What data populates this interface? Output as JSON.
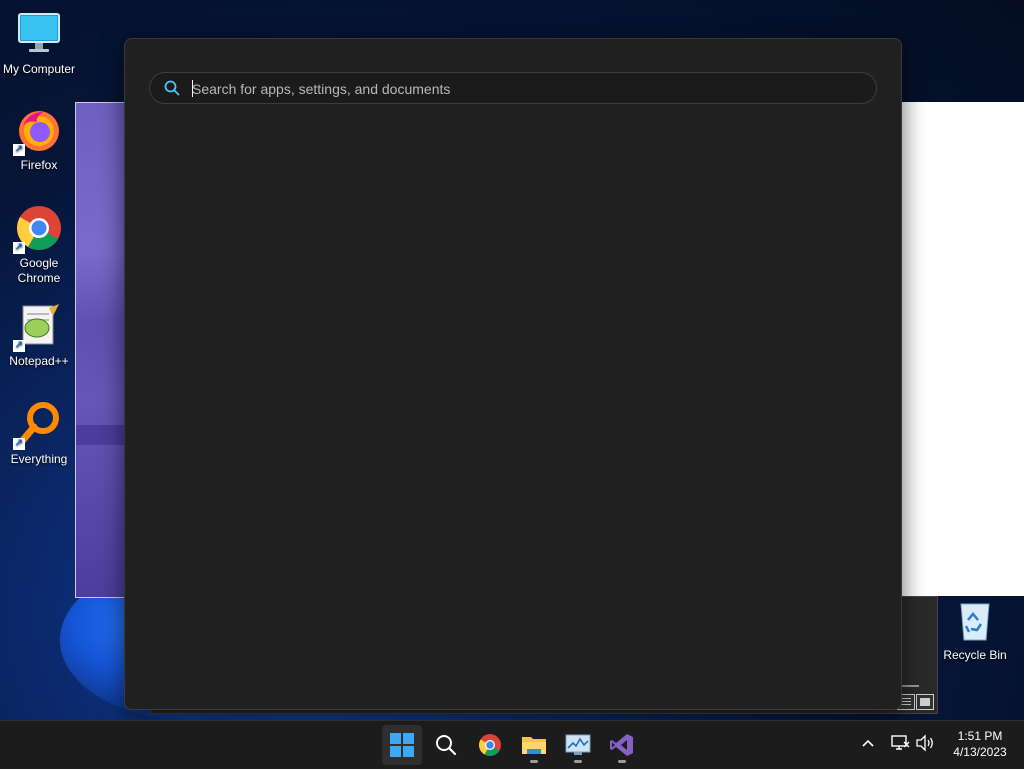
{
  "desktop": {
    "icons": [
      {
        "label": "My Computer",
        "icon": "monitor-icon"
      },
      {
        "label": "Firefox",
        "icon": "firefox-icon"
      },
      {
        "label": "Google\nChrome",
        "icon": "chrome-icon"
      },
      {
        "label": "Notepad++",
        "icon": "notepadpp-icon"
      },
      {
        "label": "Everything",
        "icon": "everything-icon"
      },
      {
        "label": "Recycle Bin",
        "icon": "recycle-bin-icon"
      }
    ]
  },
  "search": {
    "placeholder": "Search for apps, settings, and documents",
    "value": ""
  },
  "taskbar": {
    "items": [
      {
        "name": "start",
        "icon": "windows-start-icon"
      },
      {
        "name": "search",
        "icon": "search-icon"
      },
      {
        "name": "chrome",
        "icon": "chrome-icon"
      },
      {
        "name": "file-explorer",
        "icon": "folder-icon"
      },
      {
        "name": "resource-monitor",
        "icon": "monitor-chart-icon"
      },
      {
        "name": "visual-studio",
        "icon": "visual-studio-icon"
      }
    ],
    "tray": [
      "chevron-up-icon",
      "network-icon",
      "volume-icon"
    ],
    "clock": {
      "time": "1:51 PM",
      "date": "4/13/2023"
    }
  },
  "colors": {
    "panel_bg": "#202020",
    "search_accent": "#4cc2ff",
    "taskbar_bg": "#1c1c1c"
  }
}
